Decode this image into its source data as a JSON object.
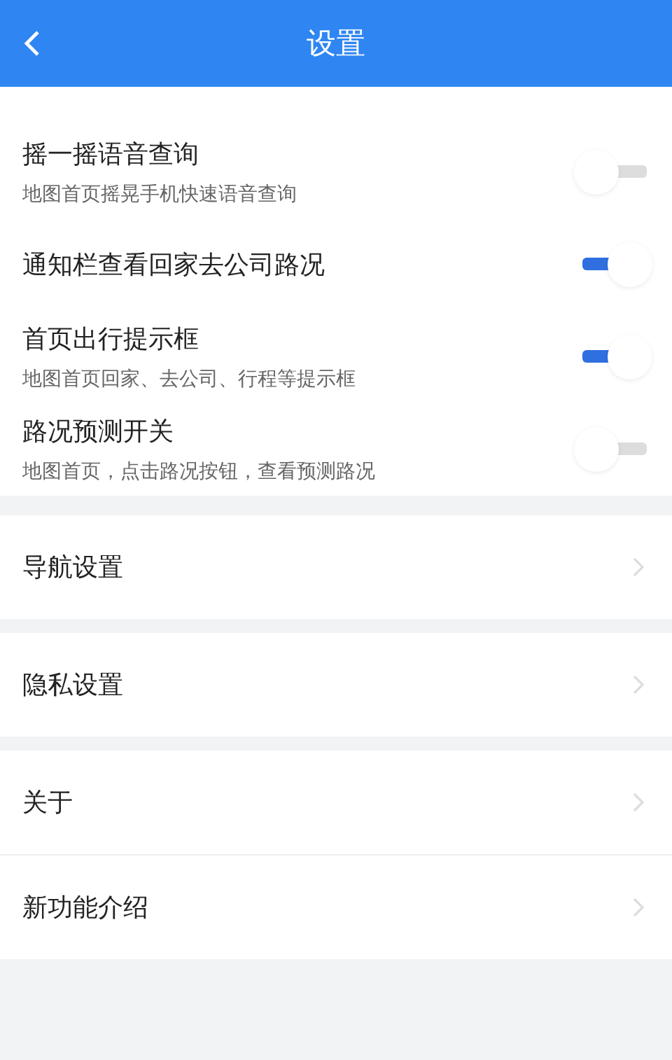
{
  "header": {
    "title": "设置"
  },
  "switch_rows": [
    {
      "title": "摇一摇语音查询",
      "subtitle": "地图首页摇晃手机快速语音查询",
      "on": false
    },
    {
      "title": "通知栏查看回家去公司路况",
      "on": true
    },
    {
      "title": "首页出行提示框",
      "subtitle": "地图首页回家、去公司、行程等提示框",
      "on": true
    },
    {
      "title": "路况预测开关",
      "subtitle": "地图首页，点击路况按钮，查看预测路况",
      "on": false
    }
  ],
  "link_groups": [
    [
      "导航设置"
    ],
    [
      "隐私设置"
    ],
    [
      "关于",
      "新功能介绍"
    ]
  ]
}
